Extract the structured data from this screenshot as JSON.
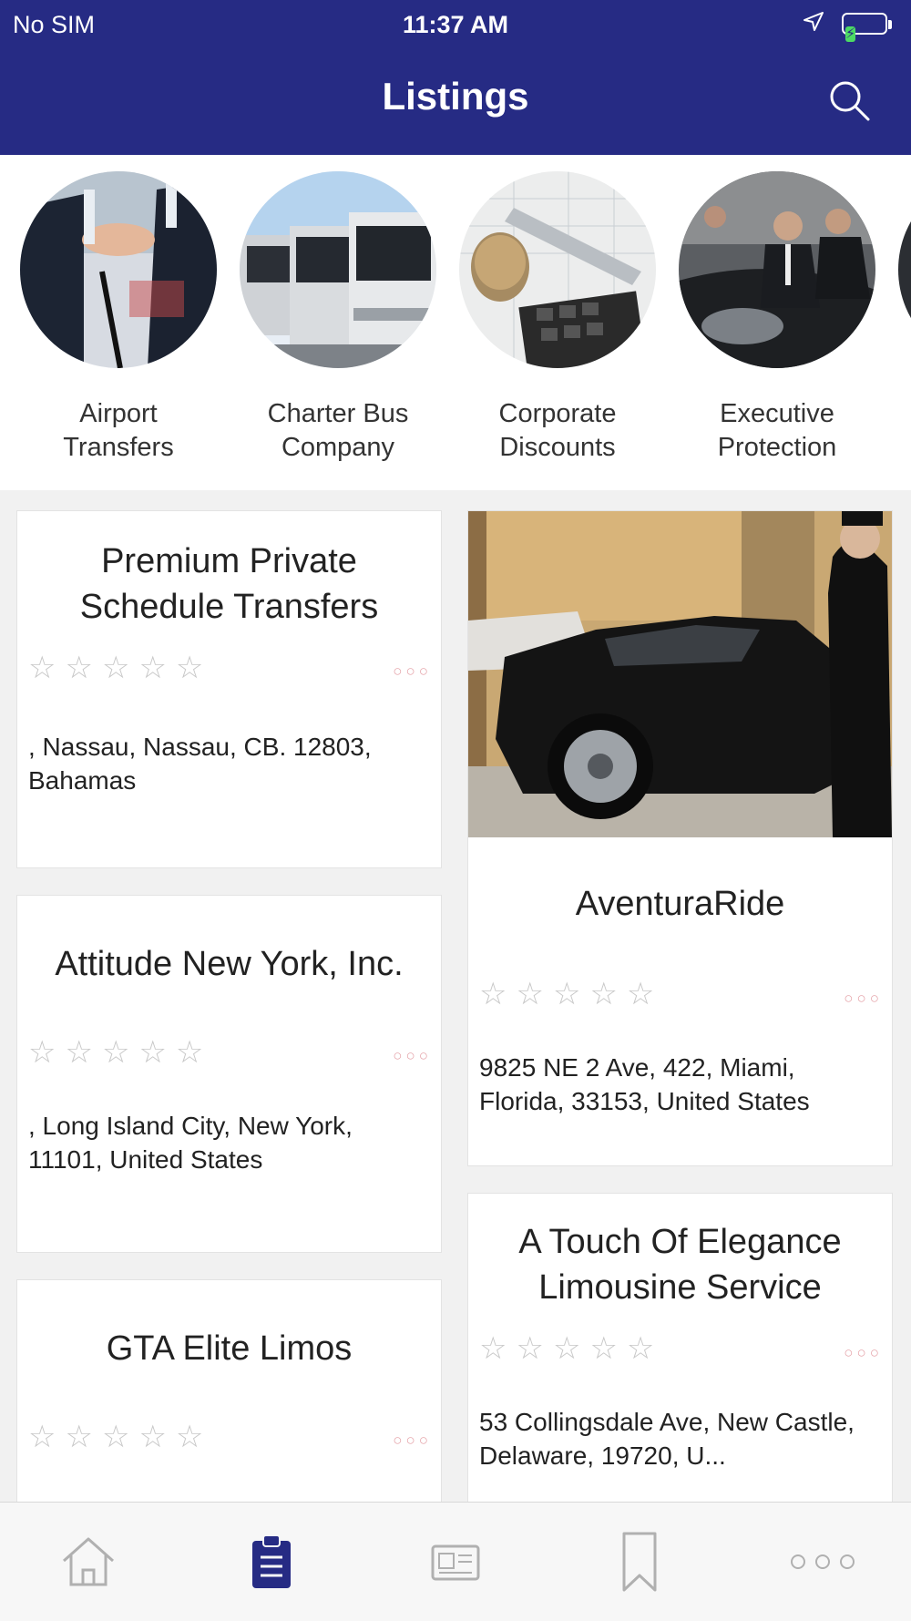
{
  "status_bar": {
    "carrier": "No SIM",
    "time": "11:37 AM",
    "battery_icon": "battery-charging-icon",
    "location_icon": "location-arrow-icon"
  },
  "header": {
    "title": "Listings",
    "search_icon": "search-icon",
    "background": "#262b84"
  },
  "categories": [
    {
      "label": "Airport\nTransfers"
    },
    {
      "label": "Charter Bus\nCompany"
    },
    {
      "label": "Corporate\nDiscounts"
    },
    {
      "label": "Executive\nProtection"
    }
  ],
  "listings": [
    {
      "name": "Premium Private Schedule Transfers",
      "rating": 0,
      "address": ", Nassau, Nassau, CB. 12803, Bahamas"
    },
    {
      "name": "AventuraRide",
      "rating": 0,
      "address": "9825 NE 2 Ave, 422, Miami, Florida, 33153, United States",
      "has_image": true
    },
    {
      "name": "Attitude New York, Inc.",
      "rating": 0,
      "address": ", Long Island City, New York, 11101, United States"
    },
    {
      "name": "A Touch Of Elegance Limousine Service",
      "rating": 0,
      "address": "53 Collingsdale Ave, New Castle, Delaware, 19720, U..."
    },
    {
      "name": "GTA Elite Limos",
      "rating": 0,
      "address": ""
    }
  ],
  "star_glyphs": "☆☆☆☆☆",
  "more_glyph": "○○○",
  "tabbar": {
    "tabs": [
      {
        "icon": "home-icon",
        "active": false
      },
      {
        "icon": "clipboard-icon",
        "active": true
      },
      {
        "icon": "news-icon",
        "active": false
      },
      {
        "icon": "bookmark-icon",
        "active": false
      },
      {
        "icon": "more-icon",
        "active": false
      }
    ],
    "active_color": "#262b84",
    "inactive_color": "#b0b0b0"
  }
}
